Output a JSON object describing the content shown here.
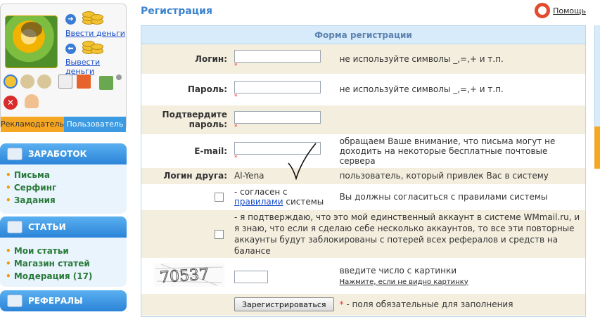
{
  "sidebar": {
    "deposit_label": "Ввести деньги",
    "withdraw_label": "Вывести деньги",
    "role_advertiser": "Рекламодатель",
    "role_user": "Пользователь",
    "sections": [
      {
        "title": "ЗАРАБОТОК",
        "items": [
          "Письма",
          "Серфинг",
          "Задания"
        ]
      },
      {
        "title": "СТАТЬИ",
        "items": [
          "Мои статьи",
          "Магазин статей",
          "Модерация (17)"
        ]
      },
      {
        "title": "РЕФЕРАЛЫ",
        "items": []
      }
    ]
  },
  "header": {
    "title": "Регистрация",
    "help_label": "Помощь"
  },
  "form": {
    "heading": "Форма регистрации",
    "login_label": "Логин:",
    "login_hint": "не используйте символы _,=,+ и т.п.",
    "password_label": "Пароль:",
    "password_hint": "не используйте символы _,=,+ и т.п.",
    "confirm_label": "Подтвердите пароль:",
    "email_label": "E-mail:",
    "email_hint": "обращаем Ваше внимание, что письма могут не доходить на некоторые бесплатные почтовые сервера",
    "friend_label": "Логин друга:",
    "friend_value": "Al-Yena",
    "friend_hint": "пользователь, который привлек Вас в систему",
    "agree_prefix": "- согласен с",
    "agree_link": "правилами",
    "agree_suffix": "системы",
    "agree_hint": "Вы должны согласиться с правилами системы",
    "single_account_text": "- я подтверждаю, что это мой единственный аккаунт в системе WMmail.ru, и я знаю, что если я сделаю себе несколько аккаунтов, то все эти повторные аккаунты будут заблокированы с потерей всех рефералов и средств на балансе",
    "captcha_text": "70537",
    "captcha_hint": "введите число с картинки",
    "captcha_refresh": "Нажмите, если не видно картинку",
    "submit_label": "Зарегистрироваться",
    "required_mark": "*",
    "required_note": "- поля обязательные для заполнения"
  }
}
